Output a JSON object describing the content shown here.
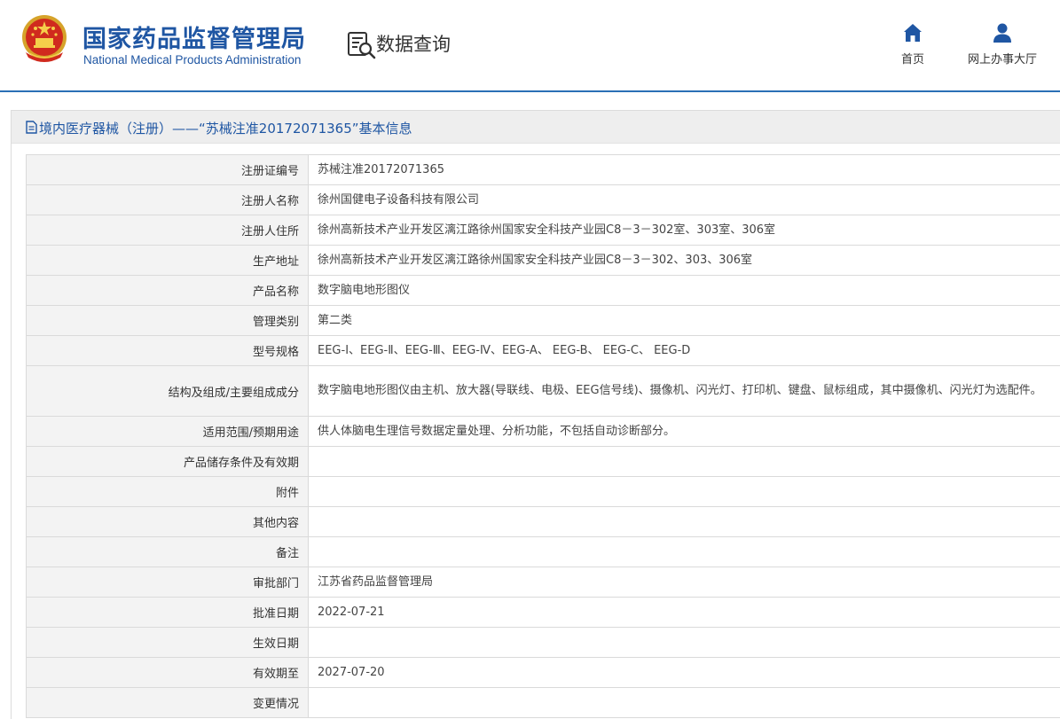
{
  "header": {
    "agency_name_cn": "国家药品监督管理局",
    "agency_name_en": "National Medical Products Administration",
    "section_label": "数据查询",
    "nav": [
      {
        "label": "首页",
        "icon": "home-icon"
      },
      {
        "label": "网上办事大厅",
        "icon": "user-icon"
      }
    ],
    "accent_color": "#1f56a3"
  },
  "panel": {
    "title": "境内医疗器械（注册）——“苏械注准20172071365”基本信息",
    "rows": [
      {
        "label": "注册证编号",
        "value": "苏械注准20172071365"
      },
      {
        "label": "注册人名称",
        "value": "徐州国健电子设备科技有限公司"
      },
      {
        "label": "注册人住所",
        "value": "徐州高新技术产业开发区漓江路徐州国家安全科技产业园C8－3－302室、303室、306室"
      },
      {
        "label": "生产地址",
        "value": "徐州高新技术产业开发区漓江路徐州国家安全科技产业园C8－3－302、303、306室"
      },
      {
        "label": "产品名称",
        "value": "数字脑电地形图仪"
      },
      {
        "label": "管理类别",
        "value": "第二类"
      },
      {
        "label": "型号规格",
        "value": "EEG-Ⅰ、EEG-Ⅱ、EEG-Ⅲ、EEG-Ⅳ、EEG-A、 EEG-B、 EEG-C、 EEG-D"
      },
      {
        "label": "结构及组成/主要组成成分",
        "value": "数字脑电地形图仪由主机、放大器(导联线、电极、EEG信号线)、摄像机、闪光灯、打印机、键盘、鼠标组成，其中摄像机、闪光灯为选配件。"
      },
      {
        "label": "适用范围/预期用途",
        "value": "供人体脑电生理信号数据定量处理、分析功能，不包括自动诊断部分。"
      },
      {
        "label": "产品储存条件及有效期",
        "value": ""
      },
      {
        "label": "附件",
        "value": ""
      },
      {
        "label": "其他内容",
        "value": ""
      },
      {
        "label": "备注",
        "value": ""
      },
      {
        "label": "审批部门",
        "value": "江苏省药品监督管理局"
      },
      {
        "label": "批准日期",
        "value": "2022-07-21"
      },
      {
        "label": "生效日期",
        "value": ""
      },
      {
        "label": "有效期至",
        "value": "2027-07-20"
      },
      {
        "label": "变更情况",
        "value": ""
      }
    ]
  }
}
